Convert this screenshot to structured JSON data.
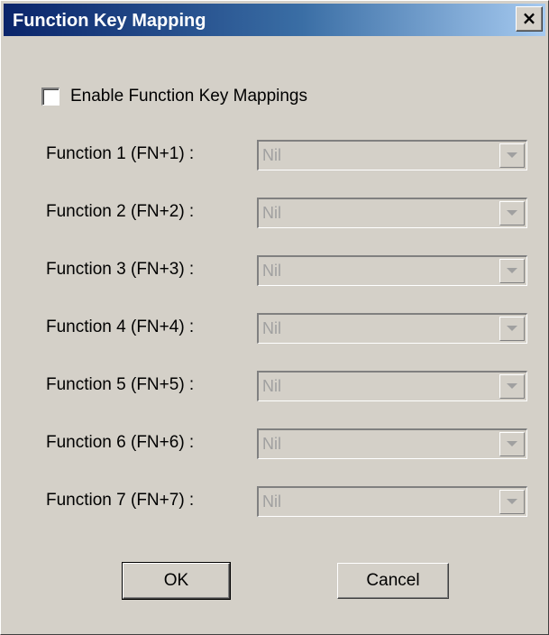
{
  "window": {
    "title": "Function Key Mapping",
    "close_glyph": "×"
  },
  "enable": {
    "label": "Enable Function Key Mappings",
    "checked": false
  },
  "functions": [
    {
      "label": "Function 1 (FN+1)  :",
      "value": "Nil"
    },
    {
      "label": "Function 2 (FN+2)  :",
      "value": "Nil"
    },
    {
      "label": "Function 3 (FN+3)  :",
      "value": "Nil"
    },
    {
      "label": "Function 4 (FN+4)  :",
      "value": "Nil"
    },
    {
      "label": "Function 5 (FN+5)  :",
      "value": "Nil"
    },
    {
      "label": "Function 6 (FN+6)  :",
      "value": "Nil"
    },
    {
      "label": "Function 7 (FN+7)  :",
      "value": "Nil"
    }
  ],
  "buttons": {
    "ok": "OK",
    "cancel": "Cancel"
  },
  "colors": {
    "face": "#d4d0c8",
    "title_start": "#0a246a",
    "title_end": "#a6caf0",
    "disabled_text": "#a0a0a0"
  }
}
